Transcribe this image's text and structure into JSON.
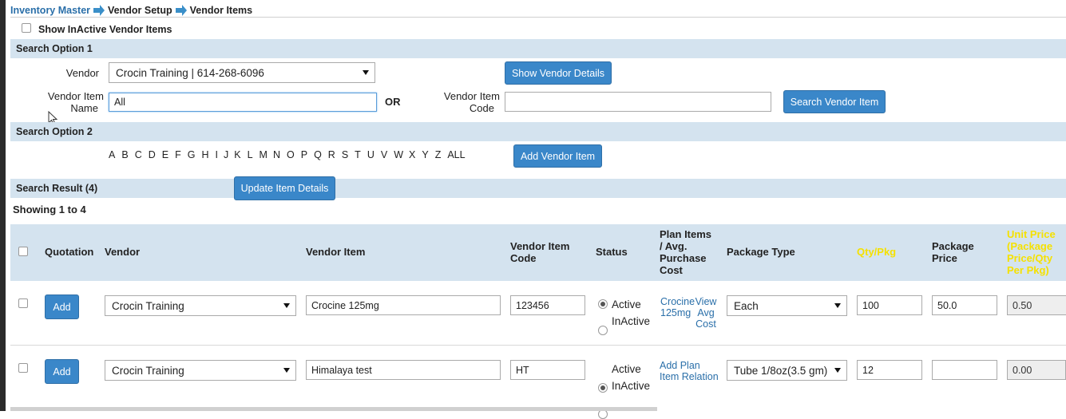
{
  "breadcrumb": [
    "Inventory Master",
    "Vendor Setup",
    "Vendor Items"
  ],
  "show_inactive_label": "Show InActive Vendor Items",
  "search1": {
    "title": "Search Option 1",
    "vendor_label": "Vendor",
    "vendor_value": "Crocin Training | 614-268-6096",
    "show_vendor_details": "Show Vendor Details",
    "vendor_item_name_label_1": "Vendor Item",
    "vendor_item_name_label_2": "Name",
    "vendor_item_name_value": "All",
    "or_label": "OR",
    "vendor_item_code_label_1": "Vendor Item",
    "vendor_item_code_label_2": "Code",
    "vendor_item_code_value": "",
    "search_button": "Search Vendor Item"
  },
  "search2": {
    "title": "Search Option 2",
    "letters": [
      "A",
      "B",
      "C",
      "D",
      "E",
      "F",
      "G",
      "H",
      "I",
      "J",
      "K",
      "L",
      "M",
      "N",
      "O",
      "P",
      "Q",
      "R",
      "S",
      "T",
      "U",
      "V",
      "W",
      "X",
      "Y",
      "Z",
      "ALL"
    ],
    "add_button": "Add Vendor Item"
  },
  "result": {
    "title": "Search Result (4)",
    "update_button": "Update Item Details",
    "showing": "Showing 1 to 4"
  },
  "table": {
    "headers": {
      "quotation": "Quotation",
      "vendor": "Vendor",
      "vendor_item": "Vendor Item",
      "code_1": "Vendor Item",
      "code_2": "Code",
      "status": "Status",
      "plan_1": "Plan Items",
      "plan_2": "/ Avg.",
      "plan_3": "Purchase",
      "plan_4": "Cost",
      "package_type": "Package Type",
      "qty_pkg": "Qty/Pkg",
      "pkg_price_1": "Package",
      "pkg_price_2": "Price",
      "unit_1": "Unit Price",
      "unit_2": "(Package",
      "unit_3": "Price/Qty",
      "unit_4": "Per Pkg)"
    },
    "rows": [
      {
        "add": "Add",
        "vendor": "Crocin Training",
        "item": "Crocine 125mg",
        "code": "123456",
        "active": "Active",
        "inactive": "InActive",
        "plan_a_1": "Crocine",
        "plan_a_2": "125mg",
        "plan_b_1": "View",
        "plan_b_2": "Avg",
        "plan_b_3": "Cost",
        "package": "Each",
        "qty": "100",
        "price": "50.0",
        "unit": "0.50"
      },
      {
        "add": "Add",
        "vendor": "Crocin Training",
        "item": "Himalaya test",
        "code": "HT",
        "active": "Active",
        "inactive": "InActive",
        "plan_link_1": "Add Plan",
        "plan_link_2": "Item Relation",
        "package": "Tube 1/8oz(3.5 gm)",
        "qty": "12",
        "price": "",
        "unit": "0.00"
      }
    ]
  },
  "colors": {
    "band": "#d4e3ef",
    "button": "#3a87c9",
    "link": "#2a6fa9",
    "highlight_header": "#f5e100"
  }
}
